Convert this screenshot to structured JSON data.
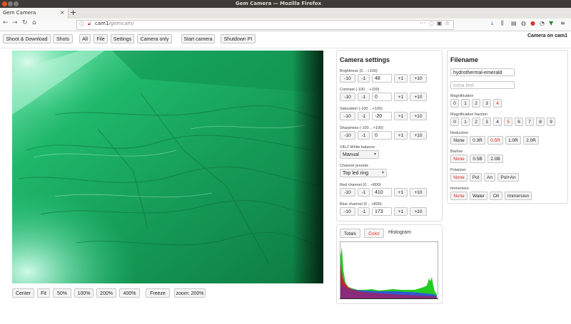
{
  "window": {
    "title": "Gem Camera — Mozilla Firefox"
  },
  "browser": {
    "tab_title": "Gem Camera",
    "url_host": "cam1",
    "url_path": "/gemcam/"
  },
  "toolbar": {
    "buttons": [
      "Shoot & Download",
      "Shots",
      "All",
      "File",
      "Settings",
      "Camera only",
      "Start camera",
      "Shutdown PI"
    ],
    "status": "Camera on cam1"
  },
  "view_controls": [
    "Center",
    "Fit",
    "50%",
    "100%",
    "200%",
    "400%",
    "Freeze"
  ],
  "zoom_label": "zoom: 200%",
  "camera_settings": {
    "title": "Camera settings",
    "sliders": [
      {
        "label": "Brightness (0 .. +100)",
        "value": "48"
      },
      {
        "label": "Contrast (-100 .. +100)",
        "value": "0"
      },
      {
        "label": "Saturation (-100 .. +100)",
        "value": "-20"
      },
      {
        "label": "Sharpness (-100 .. +100)",
        "value": "0"
      }
    ],
    "step_buttons": [
      "-10",
      "-1",
      "+1",
      "+10"
    ],
    "wb_label": "V4L2 White balance",
    "wb_value": "Manual",
    "preset_label": "Channel presets",
    "preset_value": "Top led ring",
    "channels": [
      {
        "label": "Red channel (0 .. +800)",
        "value": "410"
      },
      {
        "label": "Blue channel (0 .. +800)",
        "value": "173"
      }
    ]
  },
  "histogram": {
    "tabs": [
      "Totals",
      "Color",
      "Histogram"
    ],
    "colors": {
      "green": "#22cc22",
      "blue": "#3344ee",
      "red": "#cc2222",
      "overlap": "#8a2a7a"
    }
  },
  "filename": {
    "title": "Filename",
    "name_value": "hydrothermal-emerald",
    "extra_placeholder": "extra text",
    "magnification_label": "Magnification",
    "magnification": [
      "0",
      "1",
      "2",
      "3",
      "4"
    ],
    "magnification_selected": "4",
    "fraction_label": "Magnification fraction",
    "fraction": [
      "0",
      "1",
      "2",
      "3",
      "4",
      "5",
      "6",
      "7",
      "8",
      "9"
    ],
    "fraction_selected": "5",
    "reduction_label": "Reduction",
    "reduction": [
      "None",
      "0.3R",
      "0.5R",
      "1.0R",
      "2.0R"
    ],
    "reduction_selected": "0.5R",
    "barlow_label": "Barlow",
    "barlow": [
      "None",
      "0.5B",
      "2.0B"
    ],
    "barlow_selected": "None",
    "polarizer_label": "Polarizer",
    "polarizer": [
      "None",
      "Pol",
      "An",
      "Pol+An"
    ],
    "polarizer_selected": "None",
    "immersion_label": "Immersion",
    "immersion": [
      "None",
      "Water",
      "Oil",
      "Immersion"
    ],
    "immersion_selected": "None"
  }
}
